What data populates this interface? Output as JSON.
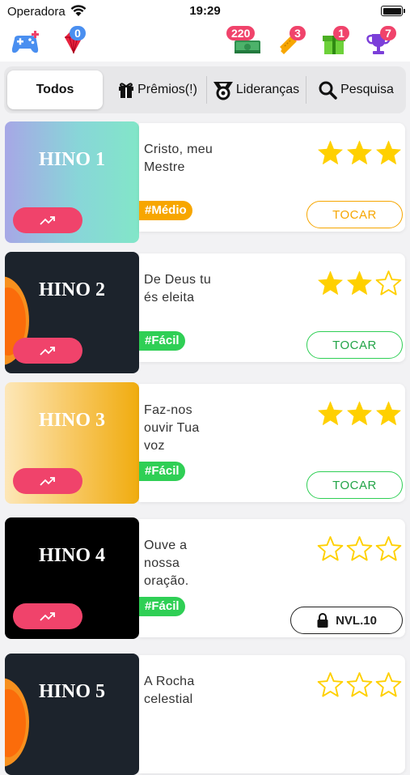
{
  "status_bar": {
    "carrier": "Operadora",
    "time": "19:29"
  },
  "top_bar": {
    "left_icons": [
      {
        "icon": "gamepad-icon"
      },
      {
        "icon": "gem-icon",
        "badge": "0"
      }
    ],
    "right_icons": [
      {
        "icon": "cash-icon",
        "badge": "220"
      },
      {
        "icon": "ticket-icon",
        "badge": "3"
      },
      {
        "icon": "gift-box-icon",
        "badge": "1"
      },
      {
        "icon": "trophy-icon",
        "badge": "7"
      }
    ]
  },
  "tabs": [
    {
      "label": "Todos",
      "icon": ""
    },
    {
      "label": "Prêmios(!)",
      "icon": "gift-icon"
    },
    {
      "label": "Lideranças",
      "icon": "medal-icon"
    },
    {
      "label": "Pesquisa",
      "icon": "search-icon"
    }
  ],
  "hymns": [
    {
      "title": "HINO 1",
      "name_lines": [
        "Cristo, meu",
        "Mestre"
      ],
      "stars": 3,
      "level": "#Médio",
      "action": "TOCAR",
      "locked": false
    },
    {
      "title": "HINO 2",
      "name_lines": [
        "De Deus tu",
        "és eleita"
      ],
      "stars": 2,
      "level": "#Fácil",
      "action": "TOCAR",
      "locked": false
    },
    {
      "title": "HINO 3",
      "name_lines": [
        "Faz-nos",
        "ouvir Tua",
        "voz"
      ],
      "stars": 3,
      "level": "#Fácil",
      "action": "TOCAR",
      "locked": false
    },
    {
      "title": "HINO 4",
      "name_lines": [
        "Ouve a",
        "nossa",
        "oração."
      ],
      "stars": 0,
      "level": "#Fácil",
      "action": "NVL.10",
      "locked": true
    },
    {
      "title": "HINO 5",
      "name_lines": [
        "A Rocha",
        "celestial"
      ],
      "stars": 0,
      "level": "",
      "action": "",
      "locked": false
    }
  ],
  "colors": {
    "accent_red": "#f0436b",
    "star": "#ffd000",
    "level_medium": "#f7a600",
    "level_easy": "#2fcf55",
    "play_orange": "#f6a600",
    "play_green": "#2fcf55",
    "badge_red": "#f0436b"
  }
}
